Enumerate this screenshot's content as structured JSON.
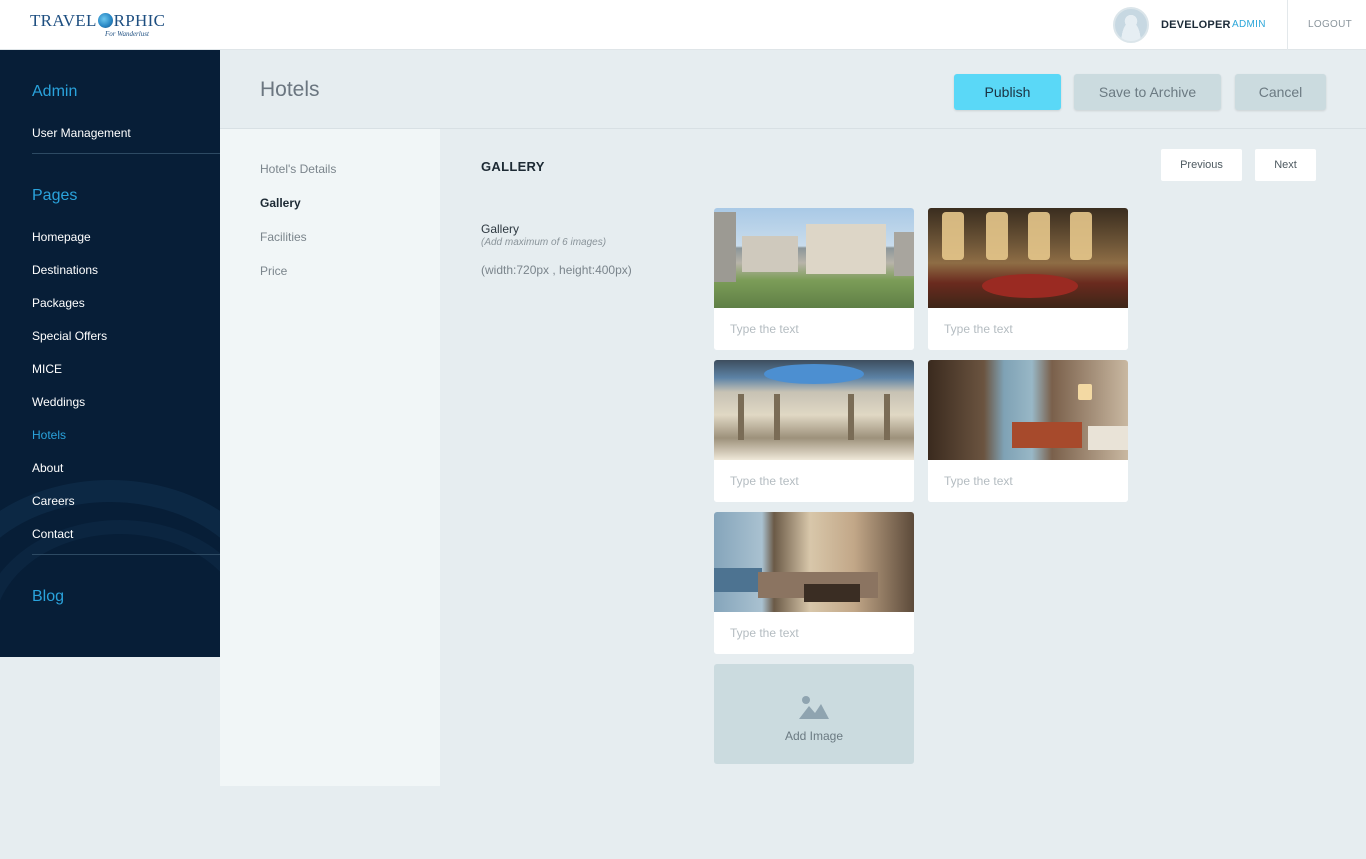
{
  "brand": {
    "name_part1": "TRAVEL",
    "name_part2": "RPHIC",
    "tagline": "For Wanderlust"
  },
  "header": {
    "user_name": "DEVELOPER",
    "user_role": "ADMIN",
    "logout_label": "LOGOUT"
  },
  "sidebar": {
    "admin_title": "Admin",
    "admin_items": [
      {
        "label": "User Management"
      }
    ],
    "pages_title": "Pages",
    "page_items": [
      {
        "label": "Homepage"
      },
      {
        "label": "Destinations"
      },
      {
        "label": "Packages"
      },
      {
        "label": "Special Offers"
      },
      {
        "label": "MICE"
      },
      {
        "label": "Weddings"
      },
      {
        "label": "Hotels",
        "active": true
      },
      {
        "label": "About"
      },
      {
        "label": "Careers"
      },
      {
        "label": "Contact"
      }
    ],
    "blog_title": "Blog"
  },
  "page": {
    "title": "Hotels",
    "actions": {
      "publish": "Publish",
      "archive": "Save to Archive",
      "cancel": "Cancel"
    }
  },
  "subnav": {
    "items": [
      {
        "label": "Hotel's Details"
      },
      {
        "label": "Gallery",
        "active": true
      },
      {
        "label": "Facilities"
      },
      {
        "label": "Price"
      }
    ]
  },
  "gallery": {
    "section_title": "GALLERY",
    "previous_label": "Previous",
    "next_label": "Next",
    "field_label": "Gallery",
    "hint": "(Add maximum of 6 images)",
    "size_note": "(width:720px , height:400px)",
    "images": [
      {
        "caption_value": "",
        "caption_placeholder": "Type the text",
        "scene": "hotel exterior"
      },
      {
        "caption_value": "",
        "caption_placeholder": "Type the text",
        "scene": "lobby with chandeliers"
      },
      {
        "caption_value": "",
        "caption_placeholder": "Type the text",
        "scene": "atrium with glass dome"
      },
      {
        "caption_value": "",
        "caption_placeholder": "Type the text",
        "scene": "guest bedroom"
      },
      {
        "caption_value": "",
        "caption_placeholder": "Type the text",
        "scene": "living room with lake view"
      }
    ],
    "add_image_label": "Add Image"
  },
  "colors": {
    "sidebar_bg": "#071e37",
    "accent": "#2aa3dc",
    "publish_bg": "#5ad8f7",
    "secondary_btn_bg": "#cbdbdf",
    "page_bg": "#e6edf0"
  }
}
